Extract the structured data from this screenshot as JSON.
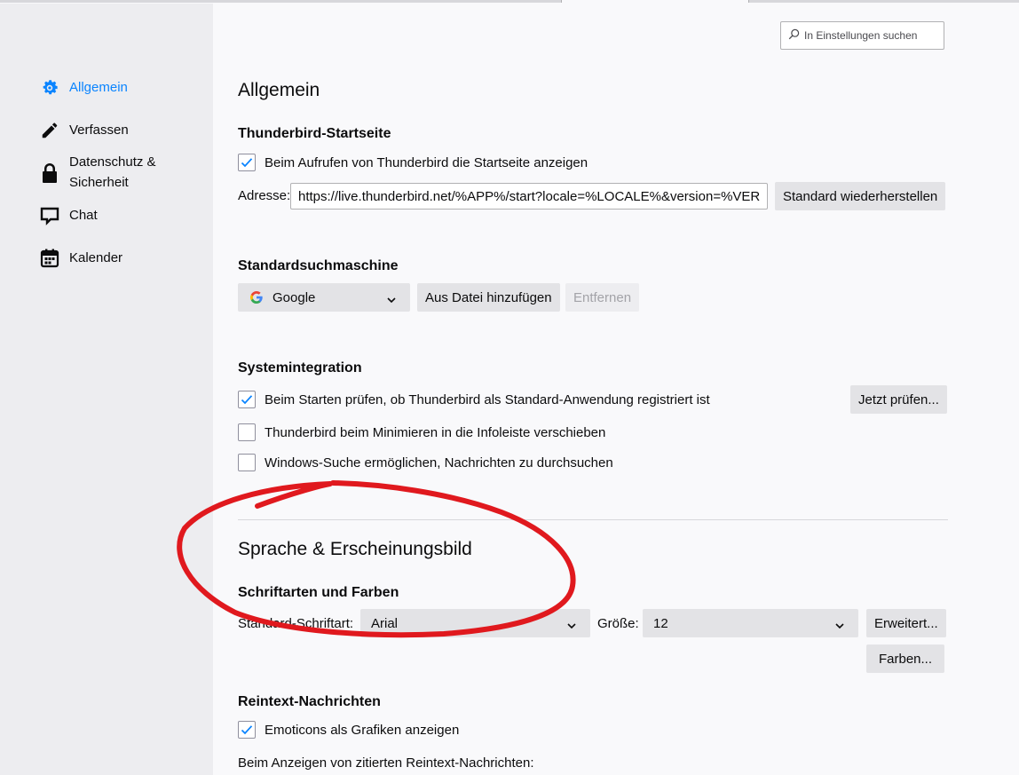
{
  "sidebar": {
    "items": [
      {
        "label": "Allgemein",
        "icon": "gear-icon",
        "active": true
      },
      {
        "label": "Verfassen",
        "icon": "pencil-icon"
      },
      {
        "label": "Datenschutz & Sicherheit",
        "icon": "lock-icon"
      },
      {
        "label": "Chat",
        "icon": "chat-icon"
      },
      {
        "label": "Kalender",
        "icon": "calendar-icon"
      }
    ]
  },
  "search": {
    "placeholder": "In Einstellungen suchen",
    "value": ""
  },
  "general": {
    "title": "Allgemein",
    "startpage": {
      "heading": "Thunderbird-Startseite",
      "show_startpage_label": "Beim Aufrufen von Thunderbird die Startseite anzeigen",
      "show_startpage_checked": true,
      "address_label": "Adresse:",
      "address_value": "https://live.thunderbird.net/%APP%/start?locale=%LOCALE%&version=%VERSIO",
      "restore_button": "Standard wiederherstellen"
    },
    "search_engine": {
      "heading": "Standardsuchmaschine",
      "selected": "Google",
      "add_button": "Aus Datei hinzufügen",
      "remove_button": "Entfernen"
    },
    "system": {
      "heading": "Systemintegration",
      "check_default_label": "Beim Starten prüfen, ob Thunderbird als Standard-Anwendung registriert ist",
      "check_default_checked": true,
      "check_now_button": "Jetzt prüfen...",
      "minimize_tray_label": "Thunderbird beim Minimieren in die Infoleiste verschieben",
      "minimize_tray_checked": false,
      "windows_search_label": "Windows-Suche ermöglichen, Nachrichten zu durchsuchen",
      "windows_search_checked": false
    }
  },
  "language": {
    "title": "Sprache & Erscheinungsbild",
    "fonts": {
      "heading": "Schriftarten und Farben",
      "default_font_label": "Standard-Schriftart:",
      "default_font_value": "Arial",
      "size_label": "Größe:",
      "size_value": "12",
      "advanced_button": "Erweitert...",
      "colors_button": "Farben..."
    },
    "plaintext": {
      "heading": "Reintext-Nachrichten",
      "emoticons_label": "Emoticons als Grafiken anzeigen",
      "emoticons_checked": true,
      "quoted_label": "Beim Anzeigen von zitierten Reintext-Nachrichten:"
    }
  },
  "colors": {
    "accent": "#0a84ff",
    "annotation": "#e0191e"
  }
}
